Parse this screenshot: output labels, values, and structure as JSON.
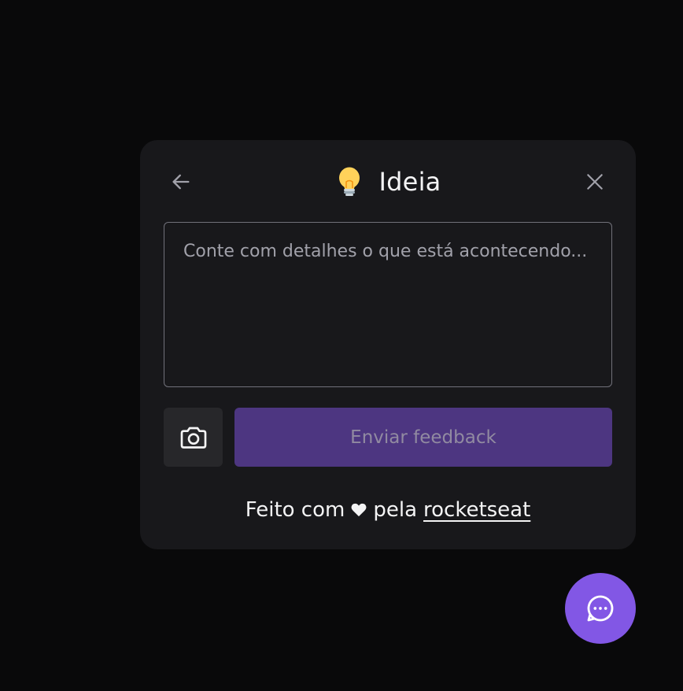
{
  "colors": {
    "page_background": "#09090a",
    "widget_background": "#18181b",
    "brand": "#8257e5",
    "submit_disabled": "#4d3681",
    "screenshot_button": "#27272a"
  },
  "header": {
    "title": "Ideia",
    "title_emoji": "lightbulb",
    "back_icon": "arrow-left-icon",
    "close_icon": "close-icon"
  },
  "form": {
    "placeholder": "Conte com detalhes o que está acontecendo...",
    "value": "",
    "screenshot_icon": "camera-icon",
    "submit_label": "Enviar feedback",
    "submit_disabled": true
  },
  "footer": {
    "prefix": "Feito com",
    "heart_icon": "heart-icon",
    "middle": "pela",
    "link_label": "rocketseat"
  },
  "fab": {
    "icon": "chat-bubble-icon"
  }
}
